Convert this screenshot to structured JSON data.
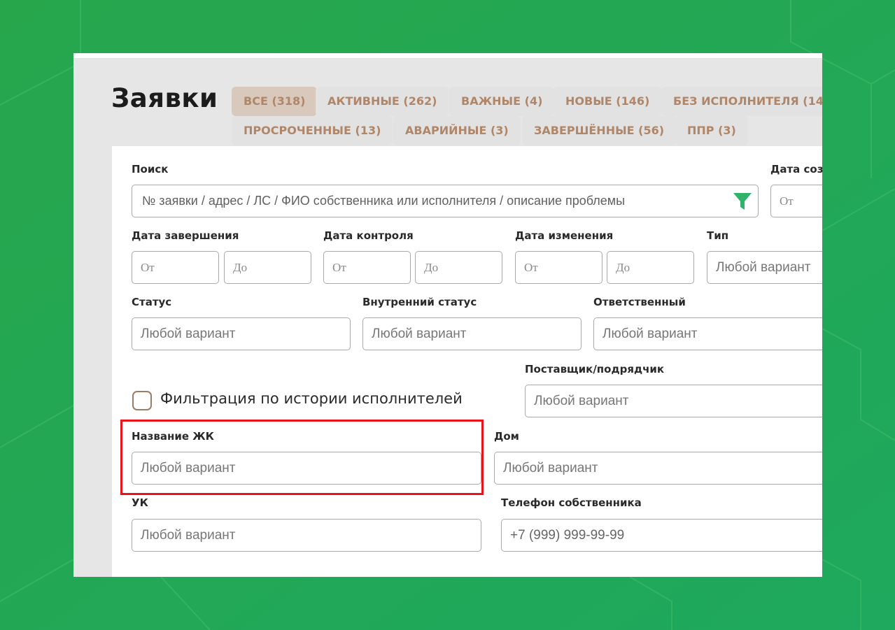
{
  "page": {
    "title": "Заявки"
  },
  "tabs": [
    {
      "label": "ВСЕ (318)",
      "active": true
    },
    {
      "label": "АКТИВНЫЕ (262)",
      "active": false
    },
    {
      "label": "ВАЖНЫЕ (4)",
      "active": false
    },
    {
      "label": "НОВЫЕ (146)",
      "active": false
    },
    {
      "label": "БЕЗ ИСПОЛНИТЕЛЯ (14",
      "active": false
    },
    {
      "label": "ПРОСРОЧЕННЫЕ (13)",
      "active": false
    },
    {
      "label": "АВАРИЙНЫЕ (3)",
      "active": false
    },
    {
      "label": "ЗАВЕРШЁННЫЕ (56)",
      "active": false
    },
    {
      "label": "ППР (3)",
      "active": false
    }
  ],
  "filters": {
    "search": {
      "label": "Поиск",
      "placeholder": "№ заявки / адрес / ЛС / ФИО собственника или исполнителя / описание проблемы"
    },
    "created_date": {
      "label": "Дата соз",
      "from": "От"
    },
    "completion_date": {
      "label": "Дата завершения",
      "from": "От",
      "to": "До"
    },
    "control_date": {
      "label": "Дата контроля",
      "from": "От",
      "to": "До"
    },
    "change_date": {
      "label": "Дата изменения",
      "from": "От",
      "to": "До"
    },
    "type": {
      "label": "Тип",
      "placeholder": "Любой вариант"
    },
    "status": {
      "label": "Статус",
      "placeholder": "Любой вариант"
    },
    "internal_status": {
      "label": "Внутренний статус",
      "placeholder": "Любой вариант"
    },
    "responsible": {
      "label": "Ответственный",
      "placeholder": "Любой вариант"
    },
    "supplier": {
      "label": "Поставщик/подрядчик",
      "placeholder": "Любой вариант"
    },
    "executor_history": {
      "label": "Фильтрация по истории исполнителей",
      "checked": false
    },
    "complex_name": {
      "label": "Название ЖК",
      "placeholder": "Любой вариант"
    },
    "house": {
      "label": "Дом",
      "placeholder": "Любой вариант"
    },
    "management_company": {
      "label": "УК",
      "placeholder": "Любой вариант"
    },
    "owner_phone": {
      "label": "Телефон собственника",
      "placeholder": "+7 (999) 999-99-99"
    }
  },
  "colors": {
    "background_green": "#23a650",
    "tab_text": "#b08668",
    "highlight_red": "#e8141b",
    "filter_icon": "#2fb36b"
  }
}
